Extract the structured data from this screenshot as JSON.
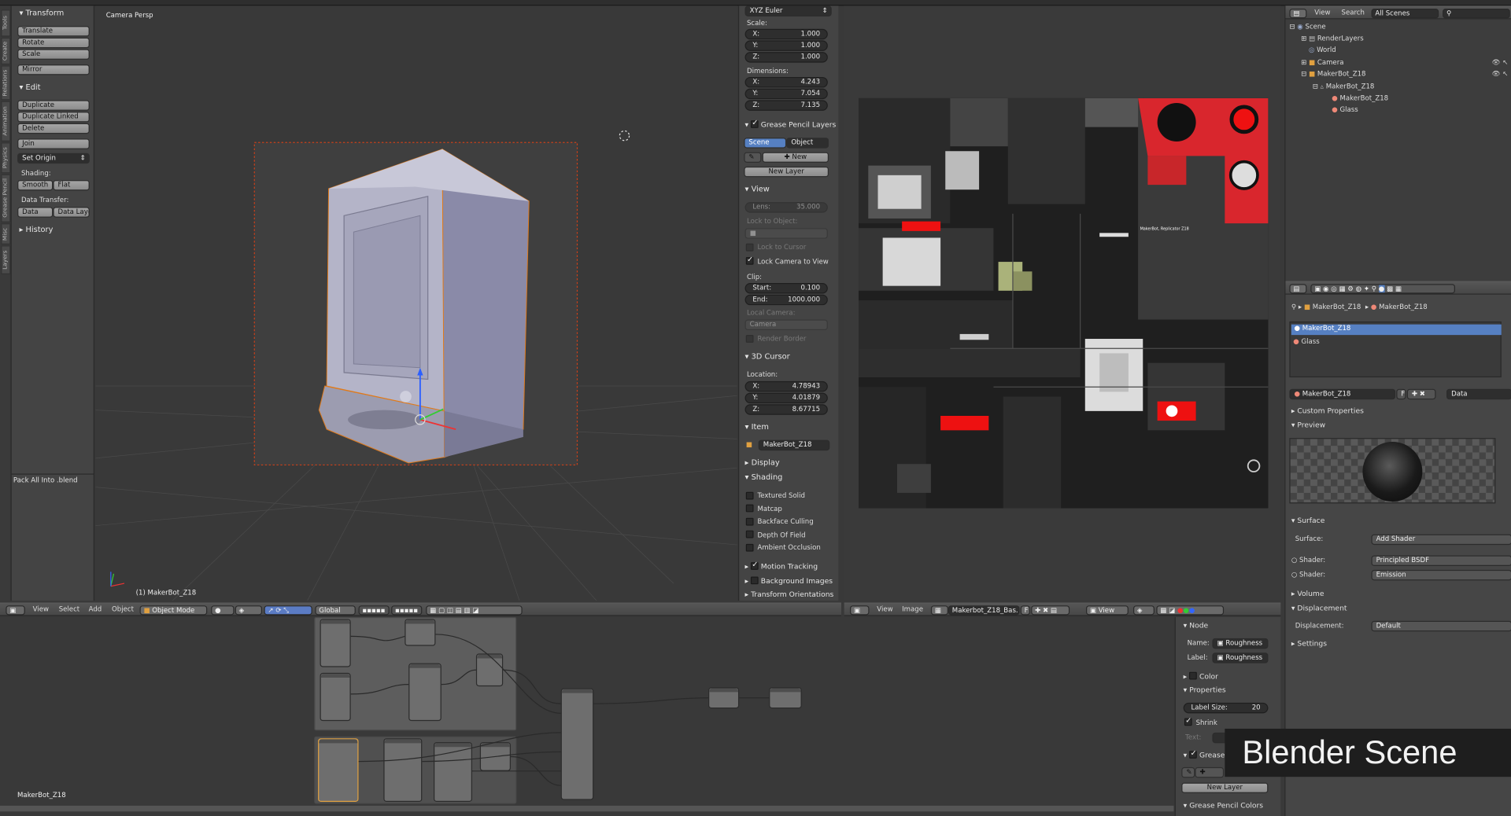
{
  "tool_shelf": {
    "tabs": [
      "Tools",
      "Create",
      "Relations",
      "Animation",
      "Physics",
      "Grease Pencil",
      "Misc",
      "Layers"
    ],
    "transform_title": "Transform",
    "translate": "Translate",
    "rotate": "Rotate",
    "scale": "Scale",
    "mirror": "Mirror",
    "edit_title": "Edit",
    "duplicate": "Duplicate",
    "duplicate_linked": "Duplicate Linked",
    "delete": "Delete",
    "join": "Join",
    "set_origin": "Set Origin",
    "shading_label": "Shading:",
    "smooth": "Smooth",
    "flat": "Flat",
    "data_transfer_label": "Data Transfer:",
    "data": "Data",
    "data_layo": "Data Layo",
    "history": "History",
    "pack_all": "Pack All Into .blend"
  },
  "viewport": {
    "label": "Camera Persp",
    "object_label": "(1) MakerBot_Z18",
    "header": {
      "view": "View",
      "select": "Select",
      "add": "Add",
      "object": "Object",
      "mode": "Object Mode",
      "orientation": "Global"
    }
  },
  "npanel": {
    "rotation_mode": "XYZ Euler",
    "scale_label": "Scale:",
    "scale": [
      {
        "k": "X:",
        "v": "1.000"
      },
      {
        "k": "Y:",
        "v": "1.000"
      },
      {
        "k": "Z:",
        "v": "1.000"
      }
    ],
    "dimensions_label": "Dimensions:",
    "dimensions": [
      {
        "k": "X:",
        "v": "4.243"
      },
      {
        "k": "Y:",
        "v": "7.054"
      },
      {
        "k": "Z:",
        "v": "7.135"
      }
    ],
    "grease_pencil_layers": "Grease Pencil Layers",
    "scene_tab": "Scene",
    "object_tab": "Object",
    "new": "New",
    "new_layer": "New Layer",
    "view_title": "View",
    "lens_k": "Lens:",
    "lens_v": "35.000",
    "lock_to_object": "Lock to Object:",
    "lock_to_cursor": "Lock to Cursor",
    "lock_camera_to_view": "Lock Camera to View",
    "clip_label": "Clip:",
    "clip_start_k": "Start:",
    "clip_start_v": "0.100",
    "clip_end_k": "End:",
    "clip_end_v": "1000.000",
    "local_camera": "Local Camera:",
    "camera": "Camera",
    "render_border": "Render Border",
    "cursor_title": "3D Cursor",
    "location_label": "Location:",
    "cursor": [
      {
        "k": "X:",
        "v": "4.78943"
      },
      {
        "k": "Y:",
        "v": "4.01879"
      },
      {
        "k": "Z:",
        "v": "8.67715"
      }
    ],
    "item_title": "Item",
    "item_name": "MakerBot_Z18",
    "display_title": "Display",
    "shading_title": "Shading",
    "shading_opts": [
      "Textured Solid",
      "Matcap",
      "Backface Culling",
      "Depth Of Field",
      "Ambient Occlusion"
    ],
    "motion_tracking": "Motion Tracking",
    "background_images": "Background Images",
    "transform_orientations": "Transform Orientations"
  },
  "image_editor": {
    "view": "View",
    "image": "Image",
    "image_name": "Makerbot_Z18_Bas...",
    "f": "F",
    "view2": "View",
    "decal_text": "MakerBot, Replicator Z18"
  },
  "outliner": {
    "view": "View",
    "search": "Search",
    "scenes": "All Scenes",
    "rows": [
      "Scene",
      "RenderLayers",
      "World",
      "Camera",
      "MakerBot_Z18",
      "MakerBot_Z18",
      "MakerBot_Z18",
      "Glass"
    ]
  },
  "properties": {
    "breadcrumb_1": "MakerBot_Z18",
    "breadcrumb_2": "MakerBot_Z18",
    "slots": [
      "MakerBot_Z18",
      "Glass"
    ],
    "material_name": "MakerBot_Z18",
    "f": "F",
    "data": "Data",
    "custom_properties": "Custom Properties",
    "preview": "Preview",
    "surface_title": "Surface",
    "surface_label": "Surface:",
    "surface_value": "Add Shader",
    "shader_label": "Shader:",
    "shader1": "Principled BSDF",
    "shader2": "Emission",
    "volume": "Volume",
    "displacement_title": "Displacement",
    "displacement_label": "Displacement:",
    "displacement_value": "Default",
    "settings": "Settings"
  },
  "node_editor": {
    "label": "MakerBot_Z18",
    "node_title": "Node",
    "name_label": "Name:",
    "name_value": "Roughness",
    "label_label": "Label:",
    "label_value": "Roughness",
    "color": "Color",
    "properties": "Properties",
    "label_size_k": "Label Size:",
    "label_size_v": "20",
    "shrink": "Shrink",
    "text_label": "Text:",
    "grease_pencil": "Grease Pencil",
    "new_layer": "New Layer",
    "gp_colors": "Grease Pencil Colors"
  },
  "banner": "Blender Scene"
}
